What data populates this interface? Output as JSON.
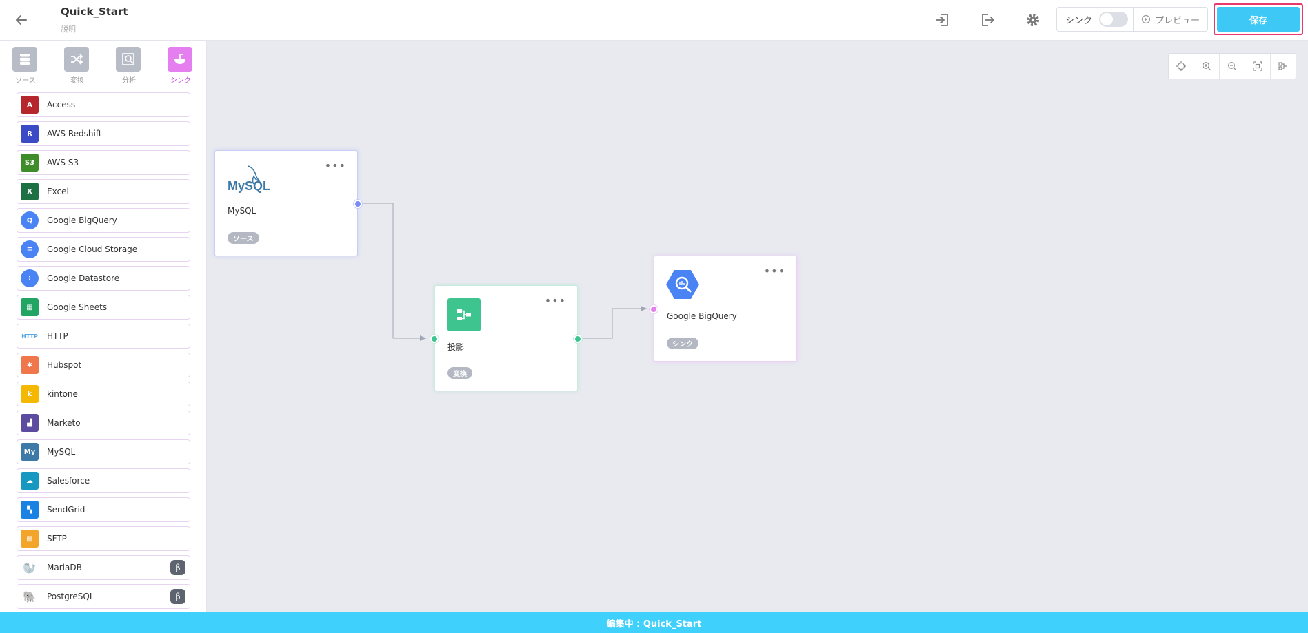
{
  "header": {
    "title": "Quick_Start",
    "subtitle": "説明",
    "sync_label": "シンク",
    "preview_label": "プレビュー",
    "save_label": "保存"
  },
  "sidebar": {
    "categories": [
      {
        "label": "ソース",
        "icon": "database-icon"
      },
      {
        "label": "変換",
        "icon": "shuffle-icon"
      },
      {
        "label": "分析",
        "icon": "analysis-icon"
      },
      {
        "label": "シンク",
        "icon": "sink-icon",
        "active": true
      }
    ],
    "items": [
      {
        "label": "Access",
        "icon": "access-icon",
        "color": "#b7262d"
      },
      {
        "label": "AWS Redshift",
        "icon": "redshift-icon",
        "color": "#3b4bc6"
      },
      {
        "label": "AWS S3",
        "icon": "s3-icon",
        "color": "#3f8c2a"
      },
      {
        "label": "Excel",
        "icon": "excel-icon",
        "color": "#1d7044"
      },
      {
        "label": "Google BigQuery",
        "icon": "bigquery-icon",
        "color": "#4a84f4"
      },
      {
        "label": "Google Cloud Storage",
        "icon": "gcs-icon",
        "color": "#4a84f4"
      },
      {
        "label": "Google Datastore",
        "icon": "datastore-icon",
        "color": "#4a84f4"
      },
      {
        "label": "Google Sheets",
        "icon": "sheets-icon",
        "color": "#22a463"
      },
      {
        "label": "HTTP",
        "icon": "http-icon",
        "color": "#5aa9e6"
      },
      {
        "label": "Hubspot",
        "icon": "hubspot-icon",
        "color": "#f0774b"
      },
      {
        "label": "kintone",
        "icon": "kintone-icon",
        "color": "#f5b800"
      },
      {
        "label": "Marketo",
        "icon": "marketo-icon",
        "color": "#5c4c9f"
      },
      {
        "label": "MySQL",
        "icon": "mysql-icon",
        "color": "#3d7aa8"
      },
      {
        "label": "Salesforce",
        "icon": "salesforce-icon",
        "color": "#1798c1"
      },
      {
        "label": "SendGrid",
        "icon": "sendgrid-icon",
        "color": "#1a82e2"
      },
      {
        "label": "SFTP",
        "icon": "sftp-icon",
        "color": "#f2a52a"
      },
      {
        "label": "MariaDB",
        "icon": "mariadb-icon",
        "color": "#a47c53",
        "beta": "β"
      },
      {
        "label": "PostgreSQL",
        "icon": "postgresql-icon",
        "color": "#336791",
        "beta": "β"
      }
    ]
  },
  "nodes": {
    "mysql": {
      "name": "MySQL",
      "tag": "ソース",
      "logo": "MySQL"
    },
    "projection": {
      "name": "投影",
      "tag": "変換"
    },
    "bigquery": {
      "name": "Google BigQuery",
      "tag": "シンク"
    }
  },
  "footer": {
    "text": "編集中 : Quick_Start"
  },
  "colors": {
    "accent": "#3dc8f5",
    "sink": "#e57ff0",
    "transform": "#3ec48e",
    "source": "#7b8cf0"
  }
}
